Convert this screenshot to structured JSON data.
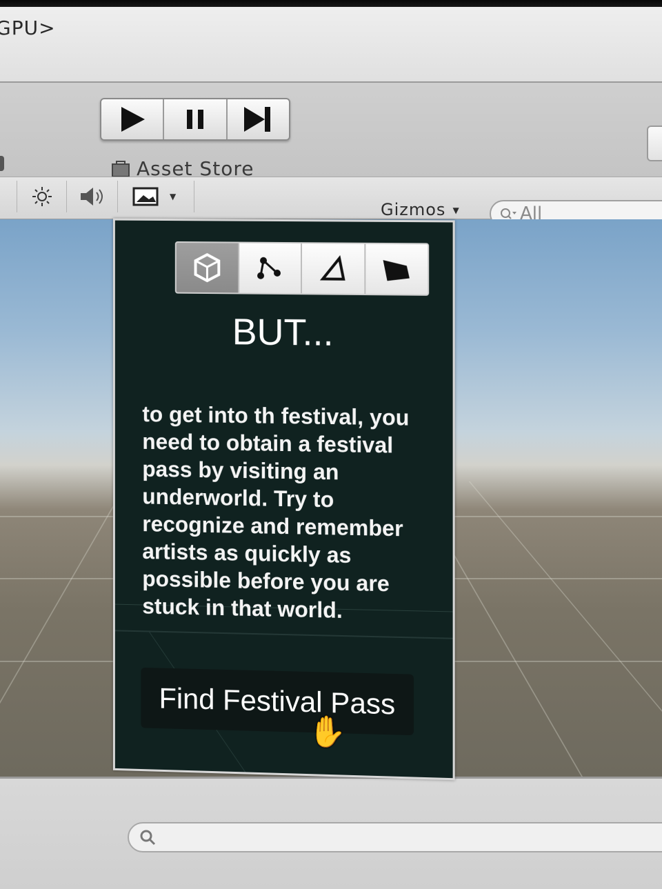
{
  "window": {
    "title_fragment": "GPU>"
  },
  "toolbar": {
    "play_controls": [
      {
        "name": "play-icon"
      },
      {
        "name": "pause-icon"
      },
      {
        "name": "step-icon"
      }
    ],
    "asset_store_label": "Asset Store"
  },
  "scene_bar": {
    "icons": [
      "sun-icon",
      "speaker-icon",
      "image-icon",
      "chevron-down-icon"
    ],
    "gizmos_label": "Gizmos",
    "search_placeholder": "All"
  },
  "dialog": {
    "tabs": [
      {
        "icon": "cube-icon",
        "active": true
      },
      {
        "icon": "nodes-icon",
        "active": false
      },
      {
        "icon": "triangle-icon",
        "active": false
      },
      {
        "icon": "shape-icon",
        "active": false
      }
    ],
    "title": "BUT...",
    "body": "to get into th festival, you need to obtain a festival pass by visiting an underworld. Try to recognize and remember artists as quickly as possible before you are stuck in that world.",
    "button_label": "Find Festival Pass"
  },
  "colors": {
    "panel_bg": "#102220",
    "button_bg": "#0e1716",
    "sky": "#9ab9d4",
    "ground": "#7a7466"
  }
}
